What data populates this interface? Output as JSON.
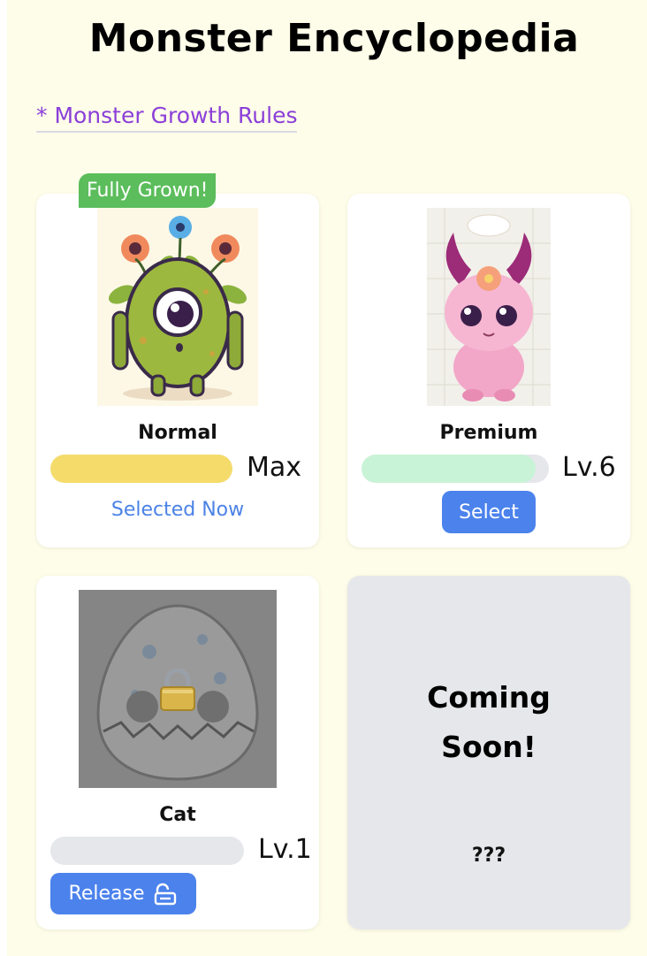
{
  "page": {
    "title": "Monster Encyclopedia"
  },
  "rules_link": {
    "label": "* Monster Growth Rules"
  },
  "monsters": [
    {
      "name": "Normal",
      "badge": "Fully Grown!",
      "progress": 1.0,
      "progress_color": "#f5dc6a",
      "level_text": "Max",
      "status_text": "Selected Now"
    },
    {
      "name": "Premium",
      "progress": 0.93,
      "progress_color": "#c9f3d6",
      "level_text": "Lv.6",
      "button_label": "Select"
    },
    {
      "name": "Cat",
      "locked": true,
      "progress": 0.0,
      "level_text": "Lv.1",
      "button_label": "Release",
      "button_icon": "unlock-icon"
    }
  ],
  "coming_soon": {
    "title_line1": "Coming",
    "title_line2": "Soon!",
    "subtitle": "???"
  },
  "colors": {
    "background": "#fefde9",
    "link": "#8b3fd9",
    "badge": "#5bbd5b",
    "button": "#4b82ec",
    "selected_text": "#4b82e6"
  }
}
